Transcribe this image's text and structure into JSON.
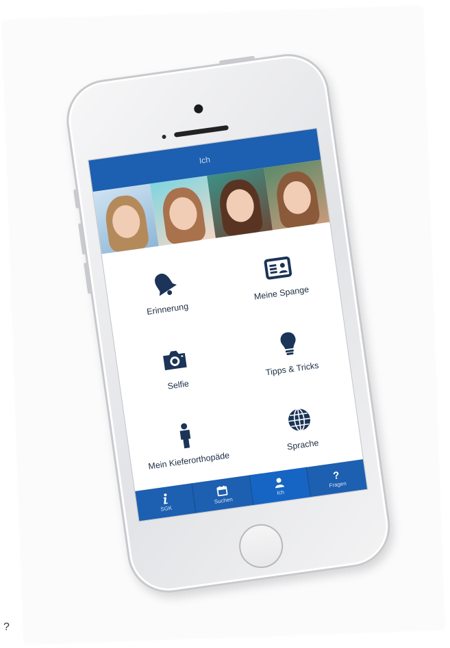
{
  "header": {
    "title": "Ich"
  },
  "menu": {
    "items": [
      {
        "label": "Erinnerung",
        "icon": "bell-icon"
      },
      {
        "label": "Meine Spange",
        "icon": "id-card-icon"
      },
      {
        "label": "Selfie",
        "icon": "camera-icon"
      },
      {
        "label": "Tipps & Tricks",
        "icon": "lightbulb-icon"
      },
      {
        "label": "Mein Kieferorthopäde",
        "icon": "person-icon"
      },
      {
        "label": "Sprache",
        "icon": "globe-icon"
      }
    ]
  },
  "tabs": [
    {
      "label": "SGK",
      "icon": "info-icon",
      "active": false
    },
    {
      "label": "Suchen",
      "icon": "calendar-icon",
      "active": false
    },
    {
      "label": "Ich",
      "icon": "user-icon",
      "active": true
    },
    {
      "label": "Fragen",
      "icon": "question-icon",
      "active": false
    }
  ],
  "stray_text": "?",
  "colors": {
    "brand_blue": "#1d5fb0",
    "icon_navy": "#1b3457"
  }
}
